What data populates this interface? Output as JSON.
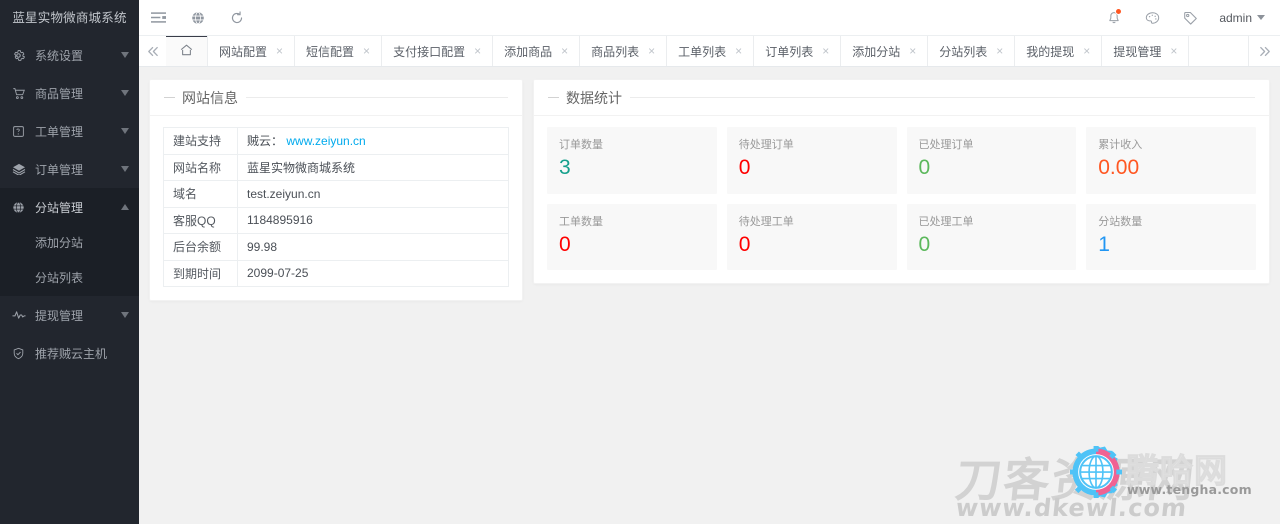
{
  "brand": {
    "title": "蓝星实物微商城系统"
  },
  "header": {
    "left_icons": [
      {
        "name": "menu-fold-icon",
        "label": "菜单折叠"
      },
      {
        "name": "globe-icon",
        "label": "全局"
      },
      {
        "name": "refresh-icon",
        "label": "刷新"
      }
    ],
    "right_icons": [
      {
        "name": "bell-icon",
        "label": "消息",
        "has_badge": true
      },
      {
        "name": "palette-icon",
        "label": "主题"
      },
      {
        "name": "tag-icon",
        "label": "标签"
      }
    ],
    "user": {
      "name": "admin",
      "caret": "▼"
    }
  },
  "tabbar": {
    "collapse_icon": "«",
    "more_icon": "»",
    "home_tab": {
      "label": "",
      "icon": "home-icon",
      "active": true
    },
    "tabs": [
      {
        "label": "网站配置",
        "close": "×"
      },
      {
        "label": "短信配置",
        "close": "×"
      },
      {
        "label": "支付接口配置",
        "close": "×"
      },
      {
        "label": "添加商品",
        "close": "×"
      },
      {
        "label": "商品列表",
        "close": "×"
      },
      {
        "label": "工单列表",
        "close": "×"
      },
      {
        "label": "订单列表",
        "close": "×"
      },
      {
        "label": "添加分站",
        "close": "×"
      },
      {
        "label": "分站列表",
        "close": "×"
      },
      {
        "label": "我的提现",
        "close": "×"
      },
      {
        "label": "提现管理",
        "close": "×"
      }
    ]
  },
  "sidebar": {
    "items": [
      {
        "label": "系统设置",
        "icon": "gear-icon",
        "caret": "▼",
        "open": false,
        "children": []
      },
      {
        "label": "商品管理",
        "icon": "cart-icon",
        "caret": "▼",
        "open": false,
        "children": []
      },
      {
        "label": "工单管理",
        "icon": "form-icon",
        "caret": "▼",
        "open": false,
        "children": []
      },
      {
        "label": "订单管理",
        "icon": "order-icon",
        "caret": "▼",
        "open": false,
        "children": []
      },
      {
        "label": "分站管理",
        "icon": "globe-icon",
        "caret": "▲",
        "open": true,
        "children": [
          {
            "label": "添加分站"
          },
          {
            "label": "分站列表"
          }
        ]
      },
      {
        "label": "提现管理",
        "icon": "pulse-icon",
        "caret": "▼",
        "open": false,
        "children": []
      },
      {
        "label": "推荐贼云主机",
        "icon": "shield-check-icon",
        "caret": "",
        "open": false,
        "children": []
      }
    ]
  },
  "site_info": {
    "title": "网站信息",
    "rows": [
      {
        "key": "建站支持",
        "value": "贼云：",
        "link": "www.zeiyun.cn"
      },
      {
        "key": "网站名称",
        "value": "蓝星实物微商城系统",
        "link": ""
      },
      {
        "key": "域名",
        "value": "test.zeiyun.cn",
        "link": ""
      },
      {
        "key": "客服QQ",
        "value": "1184895916",
        "link": ""
      },
      {
        "key": "后台余额",
        "value": "99.98",
        "link": ""
      },
      {
        "key": "到期时间",
        "value": "2099-07-25",
        "link": ""
      }
    ]
  },
  "statistics": {
    "title": "数据统计",
    "cards": [
      {
        "label": "订单数量",
        "value": "3",
        "color": "#15a08c"
      },
      {
        "label": "待处理订单",
        "value": "0",
        "color": "#ff0000"
      },
      {
        "label": "已处理订单",
        "value": "0",
        "color": "#5cb85c"
      },
      {
        "label": "累计收入",
        "value": "0.00",
        "color": "#ff5722"
      },
      {
        "label": "工单数量",
        "value": "0",
        "color": "#ff0000"
      },
      {
        "label": "待处理工单",
        "value": "0",
        "color": "#ff0000"
      },
      {
        "label": "已处理工单",
        "value": "0",
        "color": "#5cb85c"
      },
      {
        "label": "分站数量",
        "value": "1",
        "color": "#2196f3"
      }
    ]
  },
  "watermarks": {
    "dkewl": {
      "cn": "刀客资源网",
      "url": "www.dkewl.com"
    },
    "tengha": {
      "cn": "腾哈网",
      "url": "www.tengha.com"
    }
  },
  "colors": {
    "sidebar_bg": "#22262e",
    "sidebar_sub_bg": "#1b1f26",
    "content_bg": "#f1f1f1",
    "link": "#01AAED",
    "tab_active_bar": "#393d49",
    "badge": "#ff5722"
  }
}
